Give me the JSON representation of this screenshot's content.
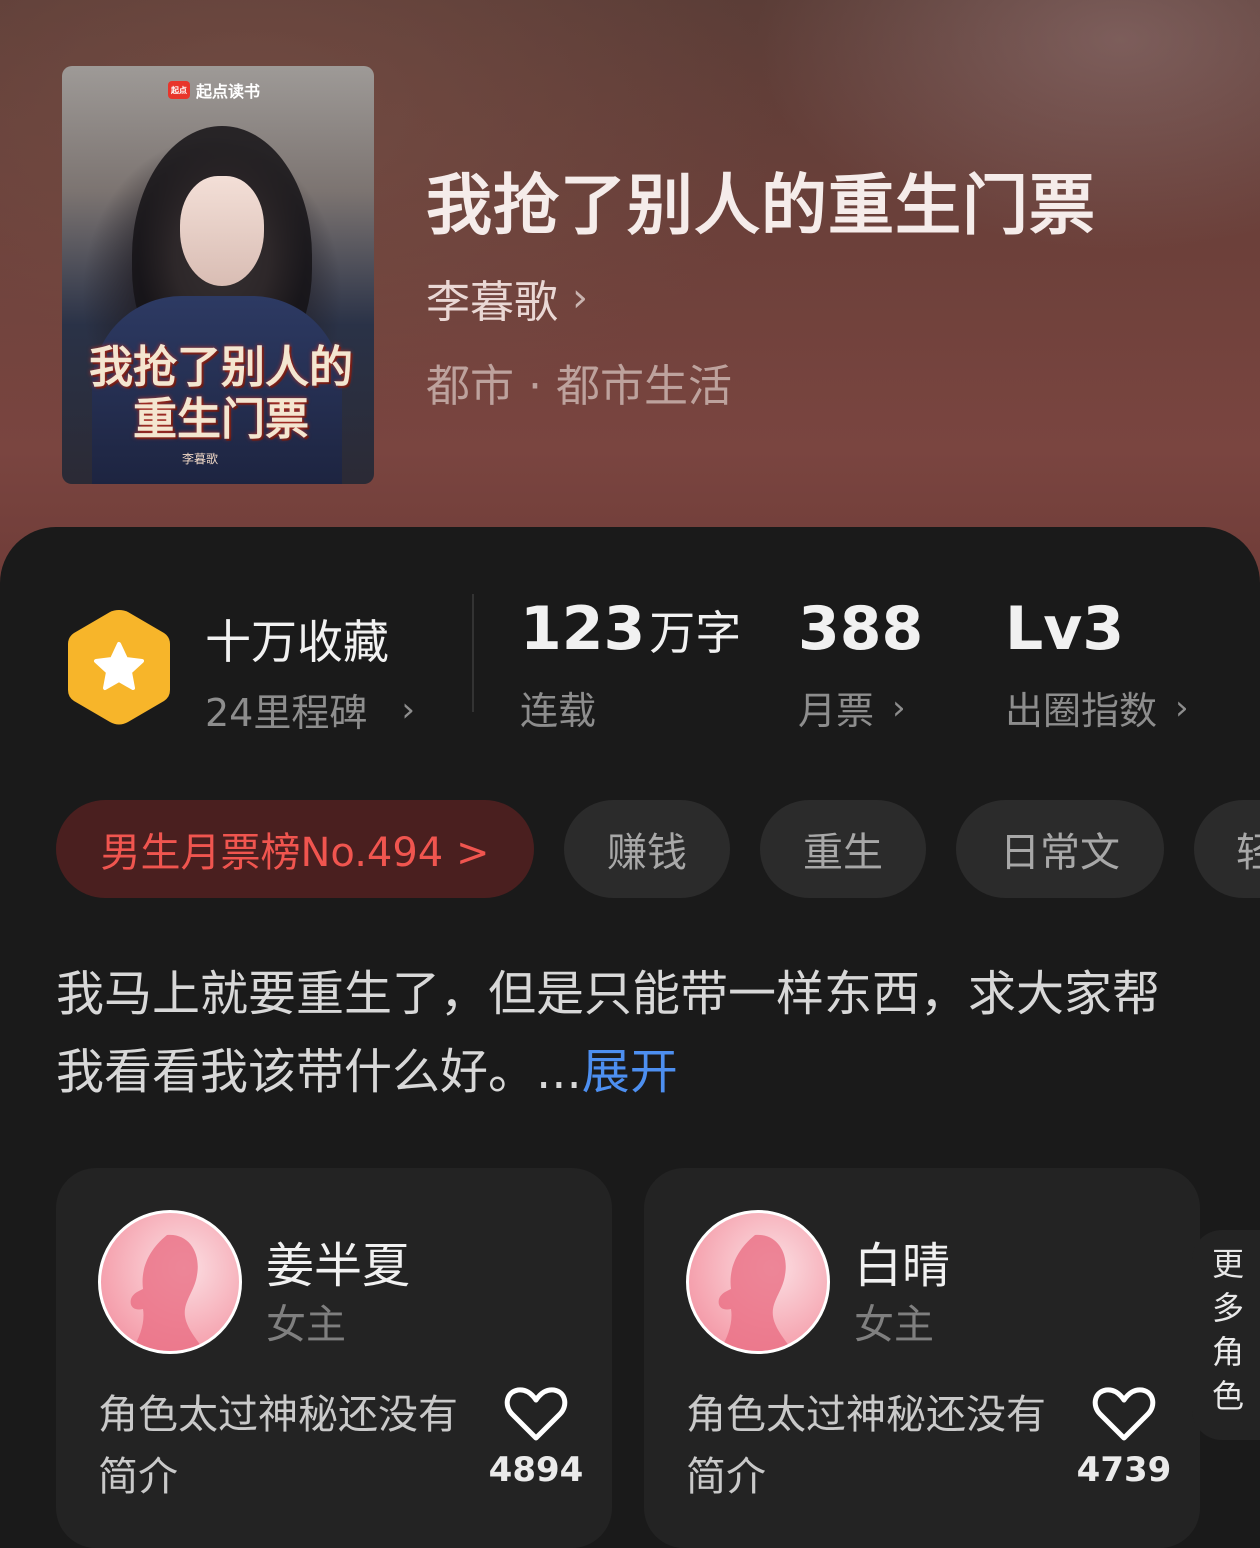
{
  "book": {
    "cover_logo": "起点读书",
    "cover_title_line1": "我抢了别人的",
    "cover_title_line2": "重生门票",
    "cover_author": "李暮歌",
    "title": "我抢了别人的重生门票",
    "author": "李暮歌",
    "genre": "都市 · 都市生活"
  },
  "stats": {
    "favorites": "十万收藏",
    "milestones": "24里程碑",
    "words_value": "123",
    "words_unit": "万字",
    "words_label": "连载",
    "monthly_votes": "388",
    "monthly_votes_label": "月票",
    "level": "Lv3",
    "level_label": "出圈指数"
  },
  "tags": [
    {
      "label": "男生月票榜No.494 >"
    },
    {
      "label": "赚钱"
    },
    {
      "label": "重生"
    },
    {
      "label": "日常文"
    },
    {
      "label": "轻"
    }
  ],
  "synopsis": {
    "text": "我马上就要重生了，但是只能带一样东西，求大家帮我看看我该带什么好。...",
    "expand": "展开"
  },
  "characters": [
    {
      "name": "姜半夏",
      "role": "女主",
      "desc": "角色太过神秘还没有简介",
      "likes": "4894"
    },
    {
      "name": "白晴",
      "role": "女主",
      "desc": "角色太过神秘还没有简介",
      "likes": "4739"
    }
  ],
  "more_roles": "更多角色",
  "colors": {
    "accent_rank": "#f0554f",
    "link": "#4d8ff0",
    "badge": "#f7b52a"
  }
}
